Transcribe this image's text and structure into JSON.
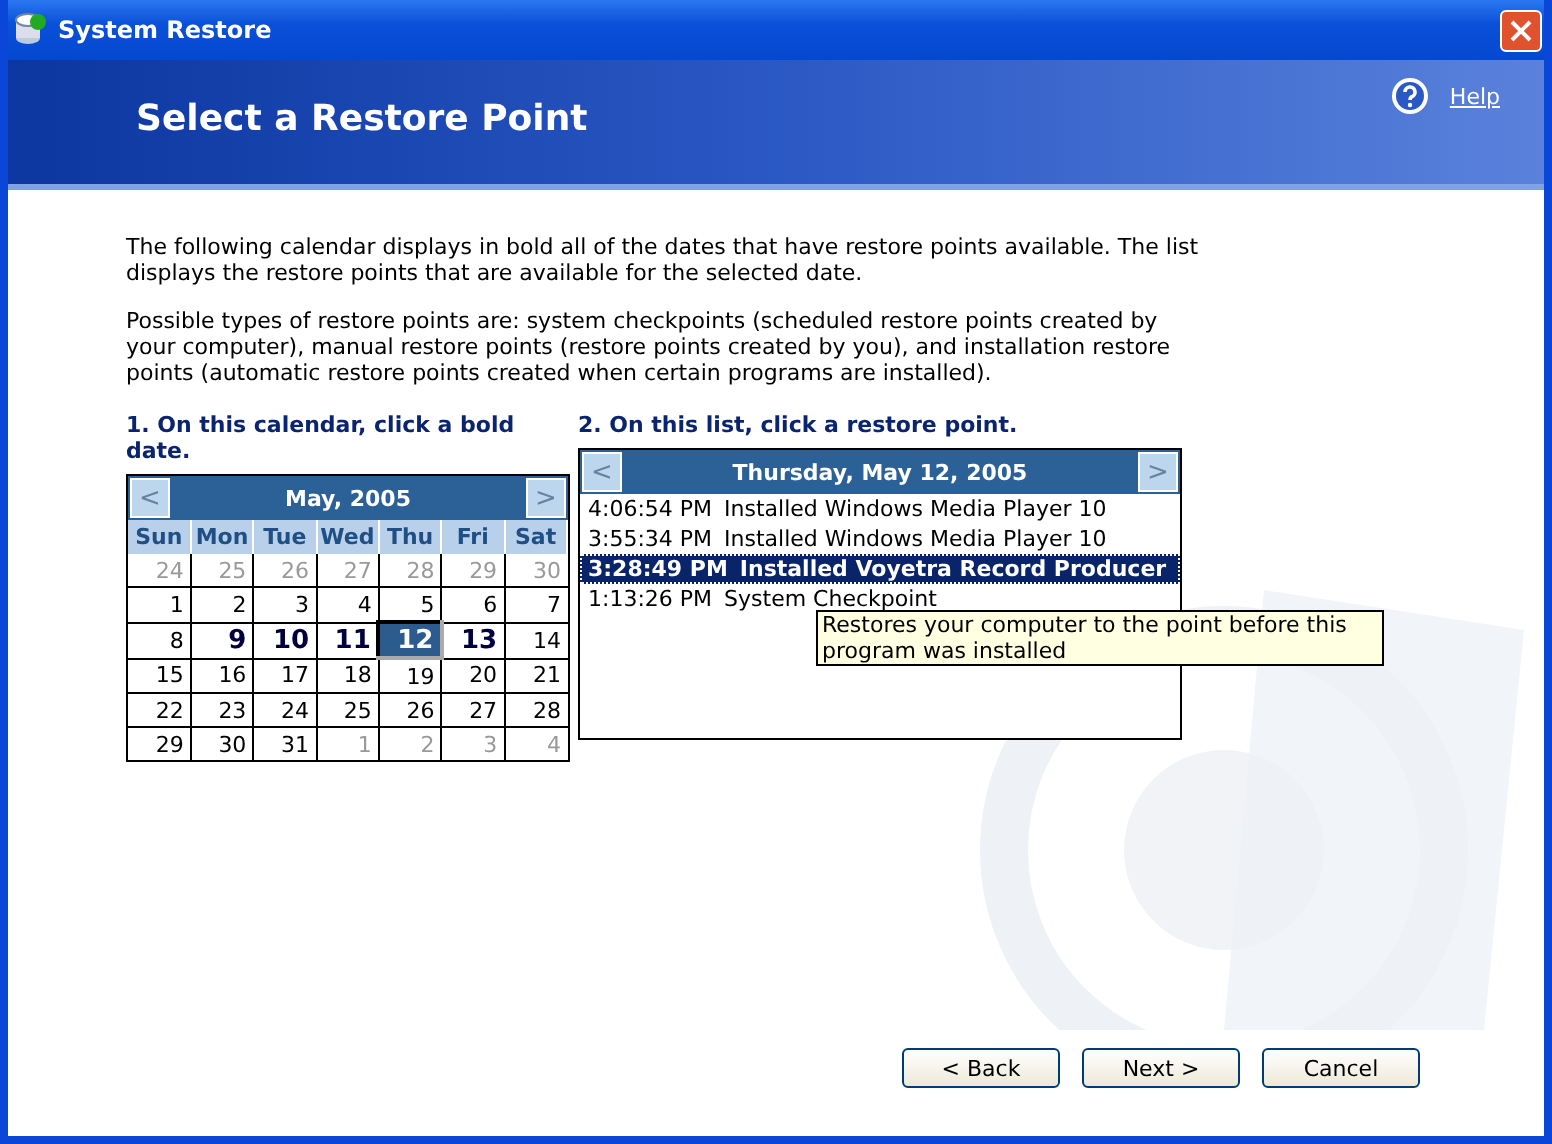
{
  "window": {
    "title": "System Restore"
  },
  "header": {
    "title": "Select a Restore Point",
    "help": "Help"
  },
  "intro": [
    "The following calendar displays in bold all of the dates that have restore points available. The list displays the restore points that are available for the selected date.",
    "Possible types of restore points are: system checkpoints (scheduled restore points created by your computer), manual restore points (restore points created by you), and installation restore points (automatic restore points created when certain programs are installed)."
  ],
  "calendar": {
    "heading": "1. On this calendar, click a bold date.",
    "prev": "<",
    "next": ">",
    "month": "May, 2005",
    "weekdays": [
      "Sun",
      "Mon",
      "Tue",
      "Wed",
      "Thu",
      "Fri",
      "Sat"
    ],
    "weeks": [
      [
        {
          "day": "24",
          "muted": true,
          "bold": false,
          "selected": false
        },
        {
          "day": "25",
          "muted": true,
          "bold": false,
          "selected": false
        },
        {
          "day": "26",
          "muted": true,
          "bold": false,
          "selected": false
        },
        {
          "day": "27",
          "muted": true,
          "bold": false,
          "selected": false
        },
        {
          "day": "28",
          "muted": true,
          "bold": false,
          "selected": false
        },
        {
          "day": "29",
          "muted": true,
          "bold": false,
          "selected": false
        },
        {
          "day": "30",
          "muted": true,
          "bold": false,
          "selected": false
        }
      ],
      [
        {
          "day": "1",
          "muted": false,
          "bold": false,
          "selected": false
        },
        {
          "day": "2",
          "muted": false,
          "bold": false,
          "selected": false
        },
        {
          "day": "3",
          "muted": false,
          "bold": false,
          "selected": false
        },
        {
          "day": "4",
          "muted": false,
          "bold": false,
          "selected": false
        },
        {
          "day": "5",
          "muted": false,
          "bold": false,
          "selected": false
        },
        {
          "day": "6",
          "muted": false,
          "bold": false,
          "selected": false
        },
        {
          "day": "7",
          "muted": false,
          "bold": false,
          "selected": false
        }
      ],
      [
        {
          "day": "8",
          "muted": false,
          "bold": false,
          "selected": false
        },
        {
          "day": "9",
          "muted": false,
          "bold": true,
          "selected": false
        },
        {
          "day": "10",
          "muted": false,
          "bold": true,
          "selected": false
        },
        {
          "day": "11",
          "muted": false,
          "bold": true,
          "selected": false
        },
        {
          "day": "12",
          "muted": false,
          "bold": true,
          "selected": true
        },
        {
          "day": "13",
          "muted": false,
          "bold": true,
          "selected": false
        },
        {
          "day": "14",
          "muted": false,
          "bold": false,
          "selected": false
        }
      ],
      [
        {
          "day": "15",
          "muted": false,
          "bold": false,
          "selected": false
        },
        {
          "day": "16",
          "muted": false,
          "bold": false,
          "selected": false
        },
        {
          "day": "17",
          "muted": false,
          "bold": false,
          "selected": false
        },
        {
          "day": "18",
          "muted": false,
          "bold": false,
          "selected": false
        },
        {
          "day": "19",
          "muted": false,
          "bold": false,
          "selected": false
        },
        {
          "day": "20",
          "muted": false,
          "bold": false,
          "selected": false
        },
        {
          "day": "21",
          "muted": false,
          "bold": false,
          "selected": false
        }
      ],
      [
        {
          "day": "22",
          "muted": false,
          "bold": false,
          "selected": false
        },
        {
          "day": "23",
          "muted": false,
          "bold": false,
          "selected": false
        },
        {
          "day": "24",
          "muted": false,
          "bold": false,
          "selected": false
        },
        {
          "day": "25",
          "muted": false,
          "bold": false,
          "selected": false
        },
        {
          "day": "26",
          "muted": false,
          "bold": false,
          "selected": false
        },
        {
          "day": "27",
          "muted": false,
          "bold": false,
          "selected": false
        },
        {
          "day": "28",
          "muted": false,
          "bold": false,
          "selected": false
        }
      ],
      [
        {
          "day": "29",
          "muted": false,
          "bold": false,
          "selected": false
        },
        {
          "day": "30",
          "muted": false,
          "bold": false,
          "selected": false
        },
        {
          "day": "31",
          "muted": false,
          "bold": false,
          "selected": false
        },
        {
          "day": "1",
          "muted": true,
          "bold": false,
          "selected": false
        },
        {
          "day": "2",
          "muted": true,
          "bold": false,
          "selected": false
        },
        {
          "day": "3",
          "muted": true,
          "bold": false,
          "selected": false
        },
        {
          "day": "4",
          "muted": true,
          "bold": false,
          "selected": false
        }
      ]
    ]
  },
  "restore_list": {
    "heading": "2. On this list, click a restore point.",
    "prev": "<",
    "next": ">",
    "date": "Thursday, May 12, 2005",
    "items": [
      {
        "time": "4:06:54 PM",
        "name": "Installed Windows Media Player 10",
        "selected": false
      },
      {
        "time": "3:55:34 PM",
        "name": "Installed Windows Media Player 10",
        "selected": false
      },
      {
        "time": "3:28:49 PM",
        "name": "Installed Voyetra Record Producer",
        "selected": true
      },
      {
        "time": "1:13:26 PM",
        "name": "System Checkpoint",
        "selected": false
      }
    ],
    "tooltip": "Restores your computer to the point before this program was installed"
  },
  "buttons": [
    {
      "label": "< Back"
    },
    {
      "label": "Next >"
    },
    {
      "label": "Cancel"
    }
  ]
}
